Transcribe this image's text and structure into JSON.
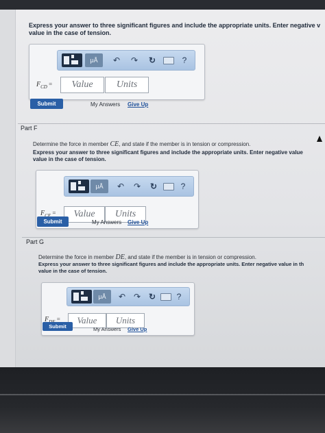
{
  "part_e": {
    "instructions_line1": "Express your answer to three significant figures and include the appropriate units. Enter negative v",
    "instructions_line2": "value in the case of tension.",
    "label": "F",
    "label_sub": "CD",
    "label_eq": " =",
    "value_placeholder": "Value",
    "units_placeholder": "Units",
    "submit": "Submit",
    "my_answers": "My Answers",
    "give_up": "Give Up"
  },
  "part_f": {
    "title": "Part F",
    "description_pre": "Determine the force in member ",
    "description_var": "CE",
    "description_post": ", and state if the member is in tension or compression.",
    "instructions_line1": "Express your answer to three significant figures and include the appropriate units. Enter negative value",
    "instructions_line2": "value in the case of tension.",
    "label": "F",
    "label_sub": "CE",
    "label_eq": " =",
    "value_placeholder": "Value",
    "units_placeholder": "Units",
    "submit": "Submit",
    "my_answers": "My Answers",
    "give_up": "Give Up"
  },
  "part_g": {
    "title": "Part G",
    "description_pre": "Determine the force in member ",
    "description_var": "DE",
    "description_post": ", and state if the member is in tension or compression.",
    "instructions_line1": "Express your answer to three significant figures and include the appropriate units. Enter negative value in th",
    "instructions_line2": "value in the case of tension.",
    "label": "F",
    "label_sub": "DE",
    "label_eq": " =",
    "value_placeholder": "Value",
    "units_placeholder": "Units",
    "submit": "Submit",
    "my_answers": "My Answers",
    "give_up": "Give Up"
  },
  "toolbar": {
    "mu_label": "μÅ",
    "undo_glyph": "↶",
    "redo_glyph": "↷",
    "reset_glyph": "↻",
    "help_glyph": "?"
  },
  "colors": {
    "submit": "#2a5fa6",
    "toolbar": "#b8cfe9",
    "link": "#1d4f99"
  }
}
